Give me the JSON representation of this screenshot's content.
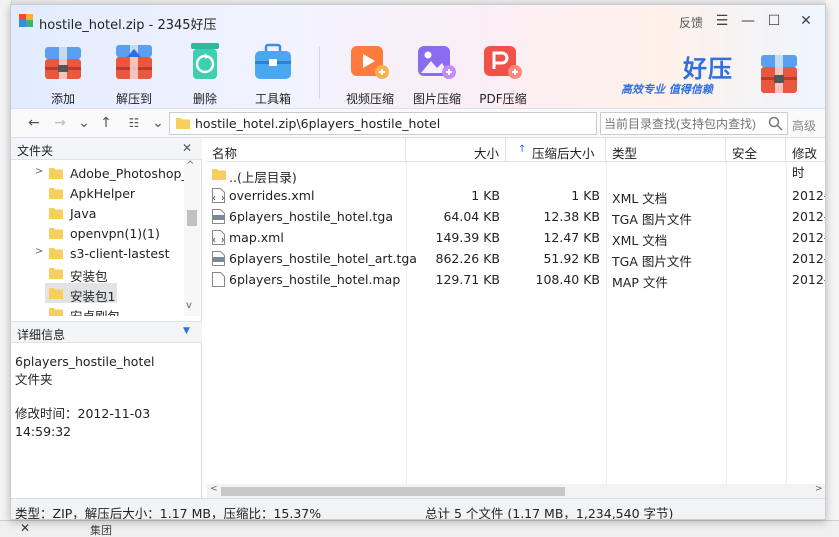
{
  "background": {
    "taskbar_close": "✕",
    "taskbar_text": "集团"
  },
  "window": {
    "title": "hostile_hotel.zip - 2345好压",
    "feedback": "反馈",
    "controls": {
      "menu": "☰",
      "minimize": "—",
      "maximize": "☐",
      "close": "✕"
    }
  },
  "toolbar": [
    {
      "label": "添加",
      "icon": "add-archive-icon"
    },
    {
      "label": "解压到",
      "icon": "extract-icon"
    },
    {
      "label": "删除",
      "icon": "recycle-delete-icon"
    },
    {
      "label": "工具箱",
      "icon": "toolbox-icon"
    },
    {
      "label": "视频压缩",
      "icon": "video-compress-icon"
    },
    {
      "label": "图片压缩",
      "icon": "image-compress-icon"
    },
    {
      "label": "PDF压缩",
      "icon": "pdf-compress-icon"
    }
  ],
  "brand": {
    "title": "好压",
    "slogan": "高效专业 值得信赖"
  },
  "address": {
    "path": "hostile_hotel.zip\\6players_hostile_hotel",
    "search_placeholder": "当前目录查找(支持包内查找)",
    "advanced": "高级"
  },
  "left_panel": {
    "header": "文件夹",
    "close": "✕",
    "tree": [
      {
        "name": "Adobe_Photoshop_",
        "expandable": true
      },
      {
        "name": "ApkHelper",
        "expandable": false
      },
      {
        "name": "Java",
        "expandable": false
      },
      {
        "name": "openvpn(1)(1)",
        "expandable": false
      },
      {
        "name": "s3-client-lastest",
        "expandable": true
      },
      {
        "name": "安装包",
        "expandable": false
      },
      {
        "name": "安装包1",
        "expandable": false,
        "selected": true
      },
      {
        "name": "安卓刷包",
        "expandable": false
      }
    ],
    "detail_header": "详细信息",
    "detail": {
      "name": "6players_hostile_hotel",
      "type": "文件夹",
      "modified_label": "修改时间：",
      "modified": "2012-11-03 14:59:32"
    }
  },
  "file_list": {
    "columns": {
      "name": "名称",
      "size": "大小",
      "packed": "压缩后大小",
      "type": "类型",
      "security": "安全",
      "modified": "修改时"
    },
    "parent": "..(上层目录)",
    "rows": [
      {
        "name": "overrides.xml",
        "size": "1 KB",
        "packed": "1 KB",
        "type": "XML 文档",
        "modified": "2012-",
        "icon": "xml-file-icon"
      },
      {
        "name": "6players_hostile_hotel.tga",
        "size": "64.04 KB",
        "packed": "12.38 KB",
        "type": "TGA 图片文件",
        "modified": "2012-",
        "icon": "tga-file-icon"
      },
      {
        "name": "map.xml",
        "size": "149.39 KB",
        "packed": "12.47 KB",
        "type": "XML 文档",
        "modified": "2012-",
        "icon": "xml-file-icon"
      },
      {
        "name": "6players_hostile_hotel_art.tga",
        "size": "862.26 KB",
        "packed": "51.92 KB",
        "type": "TGA 图片文件",
        "modified": "2012-",
        "icon": "tga-file-icon"
      },
      {
        "name": "6players_hostile_hotel.map",
        "size": "129.71 KB",
        "packed": "108.40 KB",
        "type": "MAP 文件",
        "modified": "2012-",
        "icon": "generic-file-icon"
      }
    ]
  },
  "status": {
    "left": "类型：ZIP，解压后大小：1.17 MB，压缩比：15.37%",
    "right": "总计 5 个文件 (1.17 MB，1,234,540 字节)"
  },
  "colors": {
    "accent": "#2f6fe0",
    "folder": "#f6cf5c"
  }
}
